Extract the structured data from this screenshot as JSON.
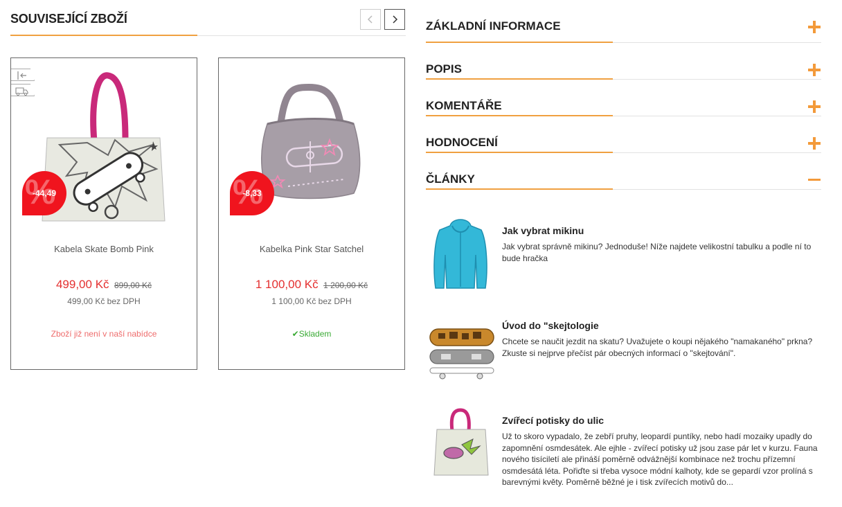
{
  "related": {
    "title": "SOUVISEJÍCÍ ZBOŽÍ",
    "products": [
      {
        "name": "Kabela Skate Bomb Pink",
        "price": "499,00 Kč",
        "old_price": "899,00 Kč",
        "net_price": "499,00 Kč bez DPH",
        "discount": "-44,49",
        "status": "Zboží již není v naší nabídce"
      },
      {
        "name": "Kabelka Pink Star Satchel",
        "price": "1 100,00 Kč",
        "old_price": "1 200,00 Kč",
        "net_price": "1 100,00 Kč bez DPH",
        "discount": "-8,33",
        "status": "Skladem"
      }
    ]
  },
  "accordion": {
    "items": [
      {
        "label": "ZÁKLADNÍ INFORMACE",
        "icon": "plus-icon"
      },
      {
        "label": "POPIS",
        "icon": "plus-icon"
      },
      {
        "label": "KOMENTÁŘE",
        "icon": "plus-icon"
      },
      {
        "label": "HODNOCENÍ",
        "icon": "plus-icon"
      },
      {
        "label": "ČLÁNKY",
        "icon": "minus-icon"
      }
    ]
  },
  "articles": [
    {
      "title": "Jak vybrat mikinu",
      "text": "Jak vybrat správně mikinu? Jednoduše! Níže najdete velikostní tabulku a podle ní to bude hračka"
    },
    {
      "title": "Úvod do \"skejtologie",
      "text": "Chcete se naučit jezdit na skatu? Uvažujete o koupi nějakého \"namakaného\" prkna? Zkuste si nejprve přečíst pár obecných informací o \"skejtování\"."
    },
    {
      "title": "Zvířecí potisky do ulic",
      "text": "Už to skoro vypadalo, že zebří pruhy, leopardí puntíky, nebo hadí mozaiky upadly do zapomnění osmdesátek. Ale ejhle - zvířecí potisky už jsou zase pár let v kurzu. Fauna nového tisíciletí ale přináší poměrně odvážnější kombinace než trochu přízemní osmdesátá léta. Pořiďte si třeba vysoce módní kalhoty, kde se gepardí vzor prolíná s barevnými květy. Poměrně běžné je i tisk zvířecích motivů do..."
    }
  ],
  "colors": {
    "accent": "#f0a040",
    "plus_icon": "#f39a3a",
    "price": "#e42f2f",
    "discount_badge": "#f0141e",
    "in_stock": "#3aaa35",
    "unavailable": "#ee6b6b"
  }
}
